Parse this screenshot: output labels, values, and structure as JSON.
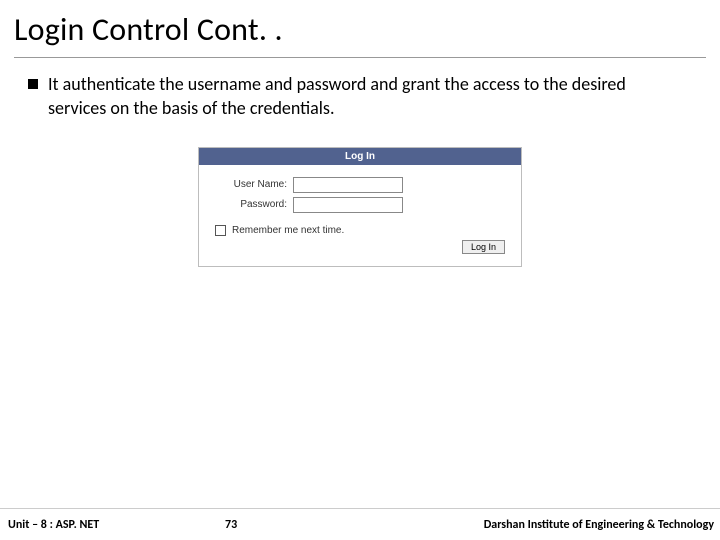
{
  "title": "Login Control Cont. .",
  "bullets": [
    "It authenticate the username and password and grant the access to the desired services on the basis of the credentials."
  ],
  "login": {
    "header": "Log In",
    "username_label": "User Name:",
    "username_value": "",
    "password_label": "Password:",
    "password_value": "",
    "remember_label": "Remember me next time.",
    "button_label": "Log In"
  },
  "footer": {
    "unit": "Unit – 8 : ASP. NET",
    "page": "73",
    "org": "Darshan Institute of Engineering & Technology"
  }
}
